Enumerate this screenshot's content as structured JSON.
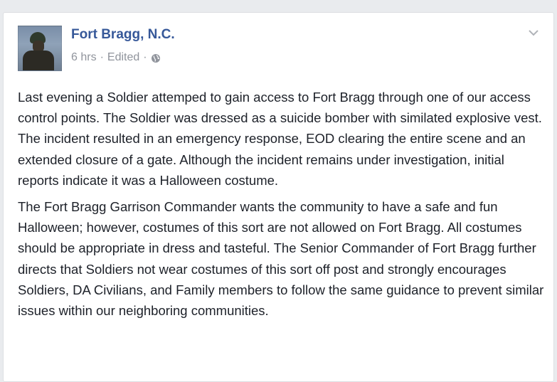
{
  "post": {
    "author": "Fort Bragg, N.C.",
    "time": "6 hrs",
    "separator": "·",
    "edited": "Edited",
    "paragraphs": [
      "Last evening a Soldier attemped to gain access to Fort Bragg through one of our access control points. The Soldier was dressed as a suicide bomber with similated explosive vest. The incident resulted in an emergency response, EOD clearing the entire scene and an extended closure of a gate. Although the incident remains under investigation, initial reports indicate it was a Halloween costume.",
      "The Fort Bragg Garrison Commander wants the community to have a safe and fun Halloween; however, costumes of this sort are not allowed on Fort Bragg. All costumes should be appropriate in dress and tasteful. The Senior Commander of Fort Bragg further directs that Soldiers not wear costumes of this sort off post and strongly encourages Soldiers, DA Civilians, and Family members to follow the same guidance to prevent similar issues within our neighboring communities."
    ]
  },
  "icons": {
    "privacy": "globe-icon",
    "menu": "chevron-down-icon"
  },
  "colors": {
    "link": "#365899",
    "meta": "#90949c",
    "text": "#1d2129",
    "background": "#e9ebee"
  }
}
